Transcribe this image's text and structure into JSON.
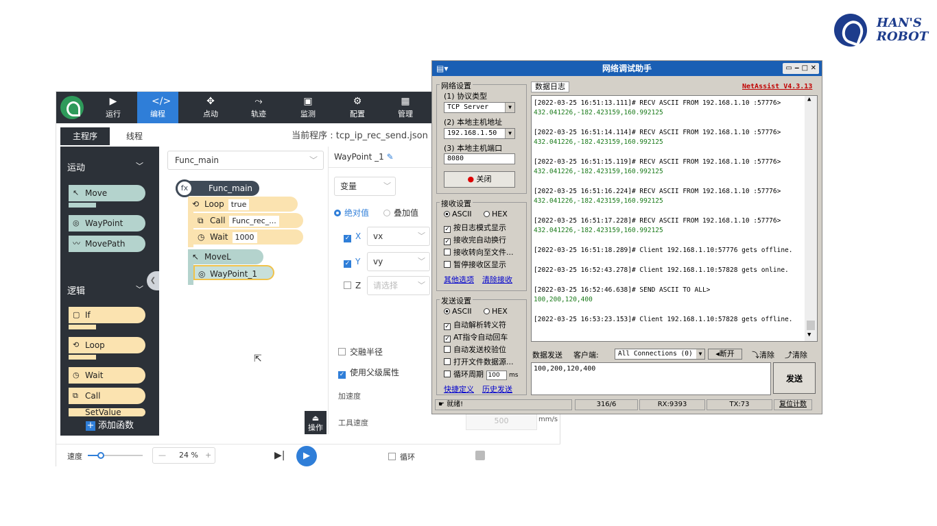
{
  "logo": {
    "line1": "HAN'S",
    "line2": "ROBOT"
  },
  "app": {
    "nav": [
      {
        "label": "运行",
        "icon": "play-icon"
      },
      {
        "label": "编程",
        "icon": "code-icon",
        "active": true
      },
      {
        "label": "点动",
        "icon": "move-arrows-icon"
      },
      {
        "label": "轨迹",
        "icon": "trajectory-icon"
      },
      {
        "label": "监测",
        "icon": "monitor-icon"
      },
      {
        "label": "配置",
        "icon": "gear-icon"
      },
      {
        "label": "管理",
        "icon": "manage-icon"
      }
    ],
    "tabs": {
      "main": "主程序",
      "thread": "线程"
    },
    "program_title": "当前程序 : tcp_ip_rec_send.json",
    "left": {
      "motion_section": "运动",
      "motion_blocks": [
        "Move",
        "WayPoint",
        "MovePath"
      ],
      "logic_section": "逻辑",
      "logic_blocks": [
        "If",
        "Loop",
        "Wait",
        "Call",
        "SetValue"
      ],
      "add_function": "添加函数"
    },
    "canvas": {
      "function_select": "Func_main",
      "fx": "fx",
      "hat": "Func_main",
      "loop_label": "Loop",
      "loop_value": "true",
      "call_label": "Call",
      "call_value": "Func_rec_...",
      "wait_label": "Wait",
      "wait_value": "1000",
      "movel_label": "MoveL",
      "waypoint_label": "WayPoint_1",
      "operate_label": "操作"
    },
    "props": {
      "title": "WayPoint _1",
      "var_select": "变量",
      "abs_label": "绝对值",
      "rel_label": "叠加值",
      "x_label": "X",
      "x_value": "vx",
      "y_label": "Y",
      "y_value": "vy",
      "z_label": "Z",
      "z_placeholder": "请选择",
      "blend_label": "交融半径",
      "inherit_label": "使用父级属性",
      "accel_label": "加速度",
      "tool_speed_label": "工具速度",
      "tool_speed_value": "500",
      "tool_speed_unit": "mm/s"
    },
    "bottom": {
      "speed_label": "速度",
      "speed_fraction": 0.24,
      "minus": "—",
      "speed_value": "24 %",
      "plus": "+",
      "loop_label": "循环"
    }
  },
  "netassist": {
    "title": "网络调试助手",
    "version": "NetAssist V4.3.13",
    "log_tab": "数据日志",
    "net_settings": "网络设置",
    "protocol_label": "(1) 协议类型",
    "protocol_value": "TCP Server",
    "host_label": "(2) 本地主机地址",
    "host_value": "192.168.1.50",
    "port_label": "(3) 本地主机端口",
    "port_value": "8080",
    "close_button": "关闭",
    "recv_settings": "接收设置",
    "ascii": "ASCII",
    "hex": "HEX",
    "recv_opts": [
      "按日志模式显示",
      "接收完自动换行",
      "接收转向至文件...",
      "暂停接收区显示"
    ],
    "recv_links": [
      "其他选项",
      "清除接收"
    ],
    "send_settings": "发送设置",
    "send_opts": [
      "自动解析转义符",
      "AT指令自动回车",
      "自动发送校验位",
      "打开文件数据源...",
      "循环周期"
    ],
    "cycle_value": "100",
    "cycle_unit": "ms",
    "send_links": [
      "快捷定义",
      "历史发送"
    ],
    "log": [
      {
        "head": "[2022-03-25 16:51:13.111]# RECV ASCII FROM 192.168.1.10 :57776>",
        "data": "432.041226,-182.423159,160.992125"
      },
      {
        "head": "[2022-03-25 16:51:14.114]# RECV ASCII FROM 192.168.1.10 :57776>",
        "data": "432.041226,-182.423159,160.992125"
      },
      {
        "head": "[2022-03-25 16:51:15.119]# RECV ASCII FROM 192.168.1.10 :57776>",
        "data": "432.041226,-182.423159,160.992125"
      },
      {
        "head": "[2022-03-25 16:51:16.224]# RECV ASCII FROM 192.168.1.10 :57776>",
        "data": "432.041226,-182.423159,160.992125"
      },
      {
        "head": "[2022-03-25 16:51:17.228]# RECV ASCII FROM 192.168.1.10 :57776>",
        "data": "432.041226,-182.423159,160.992125"
      },
      {
        "head": "[2022-03-25 16:51:18.289]# Client 192.168.1.10:57776 gets offline.",
        "data": ""
      },
      {
        "head": "[2022-03-25 16:52:43.278]# Client 192.168.1.10:57828 gets online.",
        "data": ""
      },
      {
        "head": "[2022-03-25 16:52:46.638]# SEND ASCII TO ALL>",
        "data": "100,200,120,400"
      },
      {
        "head": "[2022-03-25 16:53:23.153]# Client 192.168.1.10:57828 gets offline.",
        "data": ""
      }
    ],
    "send_tab": "数据发送",
    "client_label": "客户端:",
    "client_value": "All Connections (0)",
    "disconnect": "断开",
    "clear1": "清除",
    "clear2": "清除",
    "send_text": "100,200,120,400",
    "send_button": "发送",
    "status_ready": "就绪!",
    "status_count": "316/6",
    "rx": "RX:9393",
    "tx": "TX:73",
    "reset_count": "复位计数"
  }
}
